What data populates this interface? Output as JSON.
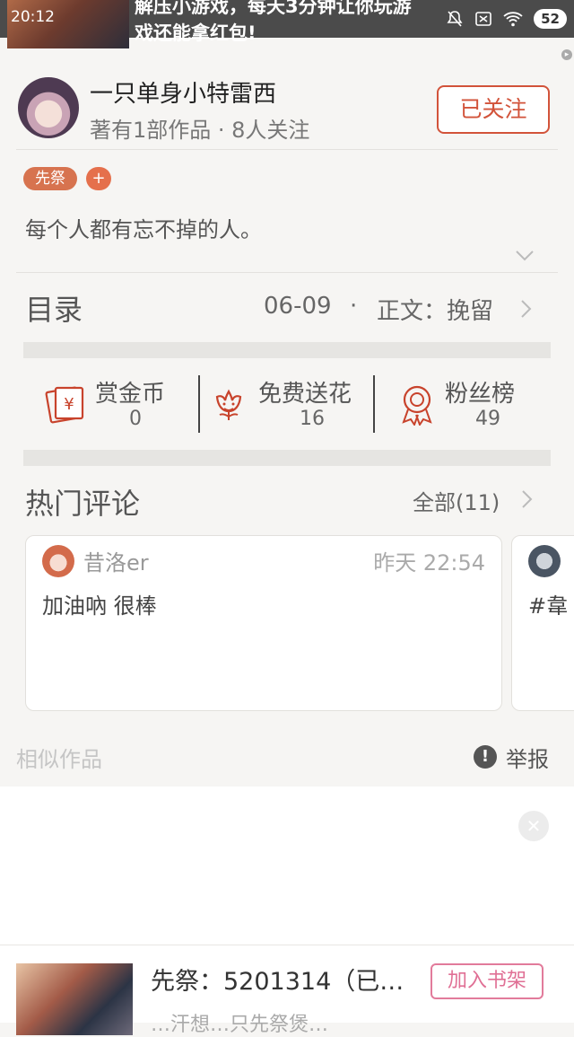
{
  "status_bar": {
    "time": "20:12",
    "ad_text_line1": "解压小游戏，每天3分钟让你玩游",
    "ad_text_line2": "戏还能拿红包!",
    "battery": "52"
  },
  "author": {
    "name": "一只单身小特雷西",
    "stats": "著有1部作品 · 8人关注",
    "follow_label": "已关注"
  },
  "book": {
    "tag": "先祭",
    "tag_add": "+",
    "intro": "每个人都有忘不掉的人。"
  },
  "toc": {
    "label": "目录",
    "date": "06-09",
    "separator": "·",
    "chapter": "正文：挽留"
  },
  "stats": [
    {
      "title": "赏金币",
      "value": "0",
      "icon": "red-envelope-icon"
    },
    {
      "title": "免费送花",
      "value": "16",
      "icon": "flower-icon"
    },
    {
      "title": "粉丝榜",
      "value": "49",
      "icon": "medal-icon"
    }
  ],
  "comments": {
    "label": "热门评论",
    "all_label": "全部(11)",
    "items": [
      {
        "user": "昔洛er",
        "time": "昨天 22:54",
        "text": "加油吶 很棒"
      },
      {
        "user": "",
        "time": "",
        "text": "#韋"
      }
    ]
  },
  "footer": {
    "similar_label": "相似作品",
    "report_label": "举报"
  },
  "bottom_bar": {
    "title": "先祭：5201314（已…",
    "subtitle": "…汗想…只先祭煲…",
    "shelf_label": "加入书架"
  },
  "colors": {
    "accent": "#d2533a",
    "tag": "#d7734f",
    "shelf": "#e07095"
  }
}
